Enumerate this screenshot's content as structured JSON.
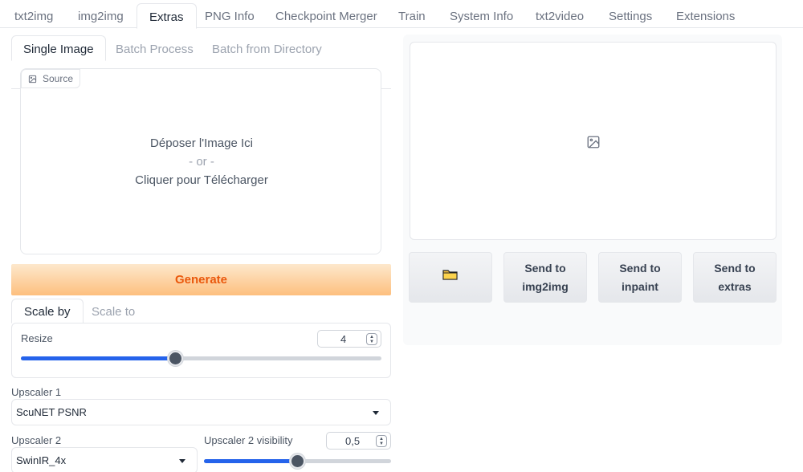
{
  "top_tabs": [
    "txt2img",
    "img2img",
    "Extras",
    "PNG Info",
    "Checkpoint Merger",
    "Train",
    "System Info",
    "txt2video",
    "Settings",
    "Extensions"
  ],
  "active_top_tab": "Extras",
  "sub_tabs": [
    "Single Image",
    "Batch Process",
    "Batch from Directory"
  ],
  "source": {
    "chip_label": "Source",
    "drop_line1": "Déposer l'Image Ici",
    "drop_or": "- or -",
    "drop_line2": "Cliquer pour Télécharger"
  },
  "generate_label": "Generate",
  "scale_tabs": [
    "Scale by",
    "Scale to"
  ],
  "resize": {
    "label": "Resize",
    "value": "4",
    "slider_fraction": 0.43
  },
  "upscaler1": {
    "label": "Upscaler 1",
    "value": "ScuNET PSNR"
  },
  "upscaler2": {
    "label": "Upscaler 2",
    "value": "SwinIR_4x"
  },
  "upscaler2_visibility": {
    "label": "Upscaler 2 visibility",
    "value": "0,5",
    "slider_fraction": 0.5
  },
  "actions": {
    "open_folder_icon": "folder-icon",
    "send_img2img": "Send to img2img",
    "send_inpaint": "Send to inpaint",
    "send_extras": "Send to extras"
  },
  "colors": {
    "accent": "#2563eb",
    "generate_text": "#ea580c"
  }
}
